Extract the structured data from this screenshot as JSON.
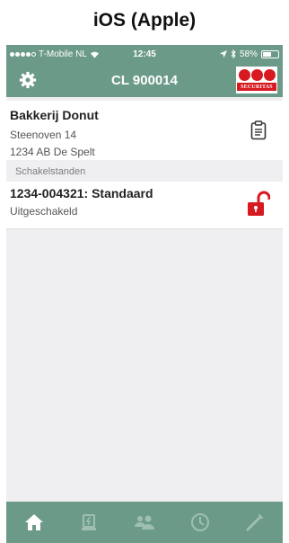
{
  "caption": "iOS (Apple)",
  "status_bar": {
    "carrier": "T-Mobile NL",
    "time": "12:45",
    "battery": "58%",
    "battery_level": 0.58
  },
  "nav": {
    "title": "CL 900014",
    "settings_icon": "gear-icon",
    "logo_text": "SECURITAS"
  },
  "location": {
    "name": "Bakkerij Donut",
    "street": "Steenoven 14",
    "city": "1234 AB  De Spelt",
    "icon": "clipboard-icon"
  },
  "section": {
    "header": "Schakelstanden"
  },
  "state": {
    "title": "1234-004321: Standaard",
    "subtitle": "Uitgeschakeld",
    "icon": "unlocked-padlock-icon"
  },
  "tabs": [
    {
      "icon": "home-icon",
      "active": true
    },
    {
      "icon": "alarm-icon",
      "active": false
    },
    {
      "icon": "contacts-icon",
      "active": false
    },
    {
      "icon": "history-icon",
      "active": false
    },
    {
      "icon": "test-icon",
      "active": false
    }
  ],
  "colors": {
    "accent": "#6c9a89",
    "alarm_red": "#d71920",
    "background": "#efeff1"
  }
}
